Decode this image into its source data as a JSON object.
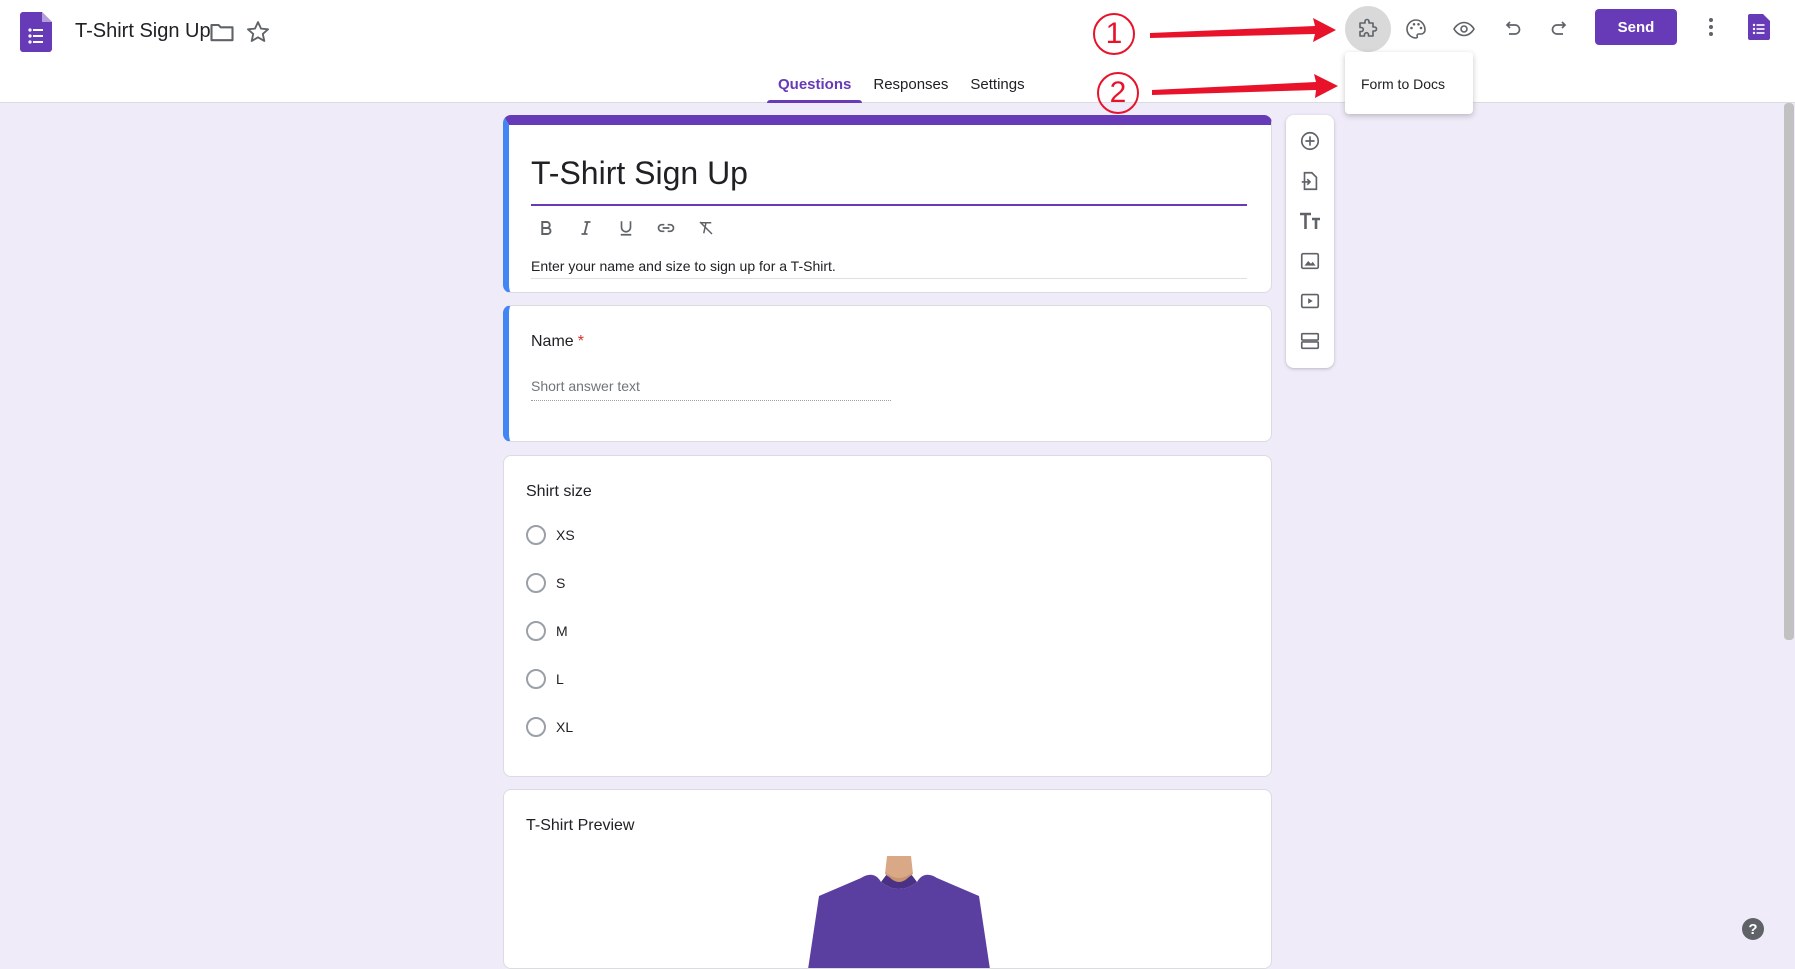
{
  "header": {
    "doc_title": "T-Shirt Sign Up",
    "send_label": "Send",
    "tabs": [
      {
        "label": "Questions"
      },
      {
        "label": "Responses"
      },
      {
        "label": "Settings"
      }
    ],
    "active_tab": "Questions"
  },
  "addons_popup": {
    "item": "Form to Docs"
  },
  "annotations": [
    "1",
    "2"
  ],
  "form": {
    "title": "T-Shirt Sign Up",
    "description": "Enter your name and size to sign up for a T-Shirt.",
    "questions": [
      {
        "title": "Name",
        "required_mark": "*",
        "type": "short_answer",
        "placeholder": "Short answer text"
      },
      {
        "title": "Shirt size",
        "type": "multiple_choice",
        "options": [
          "XS",
          "S",
          "M",
          "L",
          "XL"
        ]
      },
      {
        "title": "T-Shirt Preview",
        "type": "image"
      }
    ]
  },
  "help": {
    "label": "?"
  },
  "colors": {
    "accent": "#673ab7",
    "background": "#f0ebf8",
    "focus_bar": "#4285f4",
    "annotation": "#e8132b",
    "required": "#d93025"
  },
  "icons": {
    "header": [
      "forms-logo-icon",
      "folder-icon",
      "star-icon",
      "puzzle-addon-icon",
      "palette-icon",
      "eye-preview-icon",
      "undo-icon",
      "redo-icon",
      "more-vert-icon",
      "forms-mini-icon"
    ],
    "side_tools": [
      "add-question-icon",
      "import-questions-icon",
      "add-title-icon",
      "add-image-icon",
      "add-video-icon",
      "add-section-icon"
    ],
    "format": [
      "bold-icon",
      "italic-icon",
      "underline-icon",
      "link-icon",
      "clear-format-icon"
    ]
  }
}
